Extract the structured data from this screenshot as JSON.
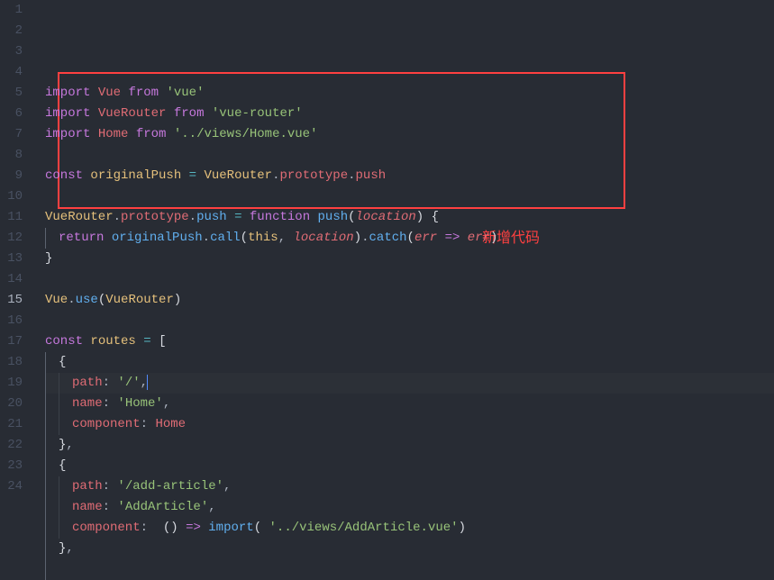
{
  "annotation": "新增代码",
  "lines": [
    {
      "n": 1,
      "segments": [
        {
          "t": "import",
          "c": "k-purple"
        },
        {
          "t": " ",
          "c": ""
        },
        {
          "t": "Vue",
          "c": "k-red"
        },
        {
          "t": " ",
          "c": ""
        },
        {
          "t": "from",
          "c": "k-purple"
        },
        {
          "t": " ",
          "c": ""
        },
        {
          "t": "'vue'",
          "c": "k-green"
        }
      ]
    },
    {
      "n": 2,
      "segments": [
        {
          "t": "import",
          "c": "k-purple"
        },
        {
          "t": " ",
          "c": ""
        },
        {
          "t": "VueRouter",
          "c": "k-red"
        },
        {
          "t": " ",
          "c": ""
        },
        {
          "t": "from",
          "c": "k-purple"
        },
        {
          "t": " ",
          "c": ""
        },
        {
          "t": "'vue-router'",
          "c": "k-green"
        }
      ]
    },
    {
      "n": 3,
      "segments": [
        {
          "t": "import",
          "c": "k-purple"
        },
        {
          "t": " ",
          "c": ""
        },
        {
          "t": "Home",
          "c": "k-red"
        },
        {
          "t": " ",
          "c": ""
        },
        {
          "t": "from",
          "c": "k-purple"
        },
        {
          "t": " ",
          "c": ""
        },
        {
          "t": "'../views/Home.vue'",
          "c": "k-green"
        }
      ]
    },
    {
      "n": 4,
      "segments": []
    },
    {
      "n": 5,
      "segments": [
        {
          "t": "const",
          "c": "k-purple"
        },
        {
          "t": " ",
          "c": ""
        },
        {
          "t": "originalPush",
          "c": "k-yellow"
        },
        {
          "t": " ",
          "c": ""
        },
        {
          "t": "=",
          "c": "k-cyan"
        },
        {
          "t": " ",
          "c": ""
        },
        {
          "t": "VueRouter",
          "c": "k-yellow"
        },
        {
          "t": ".",
          "c": "k-grey"
        },
        {
          "t": "prototype",
          "c": "k-red"
        },
        {
          "t": ".",
          "c": "k-grey"
        },
        {
          "t": "push",
          "c": "k-red"
        }
      ]
    },
    {
      "n": 6,
      "segments": []
    },
    {
      "n": 7,
      "segments": [
        {
          "t": "VueRouter",
          "c": "k-yellow"
        },
        {
          "t": ".",
          "c": "k-grey"
        },
        {
          "t": "prototype",
          "c": "k-red"
        },
        {
          "t": ".",
          "c": "k-grey"
        },
        {
          "t": "push",
          "c": "k-blue"
        },
        {
          "t": " ",
          "c": ""
        },
        {
          "t": "=",
          "c": "k-cyan"
        },
        {
          "t": " ",
          "c": ""
        },
        {
          "t": "function",
          "c": "k-purple"
        },
        {
          "t": " ",
          "c": ""
        },
        {
          "t": "push",
          "c": "k-blue"
        },
        {
          "t": "(",
          "c": "k-white"
        },
        {
          "t": "location",
          "c": "k-red italic"
        },
        {
          "t": ")",
          "c": "k-white"
        },
        {
          "t": " ",
          "c": ""
        },
        {
          "t": "{",
          "c": "k-white"
        }
      ]
    },
    {
      "n": 8,
      "indent": 1,
      "segments": [
        {
          "t": "return",
          "c": "k-purple"
        },
        {
          "t": " ",
          "c": ""
        },
        {
          "t": "originalPush",
          "c": "k-blue"
        },
        {
          "t": ".",
          "c": "k-grey"
        },
        {
          "t": "call",
          "c": "k-blue"
        },
        {
          "t": "(",
          "c": "k-white"
        },
        {
          "t": "this",
          "c": "k-yellow"
        },
        {
          "t": ", ",
          "c": "k-grey"
        },
        {
          "t": "location",
          "c": "k-red italic"
        },
        {
          "t": ")",
          "c": "k-white"
        },
        {
          "t": ".",
          "c": "k-grey"
        },
        {
          "t": "catch",
          "c": "k-blue"
        },
        {
          "t": "(",
          "c": "k-white"
        },
        {
          "t": "err",
          "c": "k-red italic"
        },
        {
          "t": " ",
          "c": ""
        },
        {
          "t": "=>",
          "c": "k-purple"
        },
        {
          "t": " ",
          "c": ""
        },
        {
          "t": "err",
          "c": "k-red italic"
        },
        {
          "t": ")",
          "c": "k-white"
        }
      ]
    },
    {
      "n": 9,
      "segments": [
        {
          "t": "}",
          "c": "k-white"
        }
      ]
    },
    {
      "n": 10,
      "segments": []
    },
    {
      "n": 11,
      "segments": [
        {
          "t": "Vue",
          "c": "k-yellow"
        },
        {
          "t": ".",
          "c": "k-grey"
        },
        {
          "t": "use",
          "c": "k-blue"
        },
        {
          "t": "(",
          "c": "k-white"
        },
        {
          "t": "VueRouter",
          "c": "k-yellow"
        },
        {
          "t": ")",
          "c": "k-white"
        }
      ]
    },
    {
      "n": 12,
      "segments": []
    },
    {
      "n": 13,
      "segments": [
        {
          "t": "const",
          "c": "k-purple"
        },
        {
          "t": " ",
          "c": ""
        },
        {
          "t": "routes",
          "c": "k-yellow"
        },
        {
          "t": " ",
          "c": ""
        },
        {
          "t": "=",
          "c": "k-cyan"
        },
        {
          "t": " ",
          "c": ""
        },
        {
          "t": "[",
          "c": "k-white"
        }
      ]
    },
    {
      "n": 14,
      "indent": 1,
      "segments": [
        {
          "t": "{",
          "c": "k-white"
        }
      ]
    },
    {
      "n": 15,
      "active": true,
      "indent": 2,
      "segments": [
        {
          "t": "path",
          "c": "k-red"
        },
        {
          "t": ": ",
          "c": "k-grey"
        },
        {
          "t": "'/'",
          "c": "k-green"
        },
        {
          "t": ",",
          "c": "k-grey"
        }
      ],
      "cursor": true
    },
    {
      "n": 16,
      "indent": 2,
      "segments": [
        {
          "t": "name",
          "c": "k-red"
        },
        {
          "t": ": ",
          "c": "k-grey"
        },
        {
          "t": "'Home'",
          "c": "k-green"
        },
        {
          "t": ",",
          "c": "k-grey"
        }
      ]
    },
    {
      "n": 17,
      "indent": 2,
      "segments": [
        {
          "t": "component",
          "c": "k-red"
        },
        {
          "t": ": ",
          "c": "k-grey"
        },
        {
          "t": "Home",
          "c": "k-red"
        }
      ]
    },
    {
      "n": 18,
      "indent": 1,
      "segments": [
        {
          "t": "}",
          "c": "k-white"
        },
        {
          "t": ",",
          "c": "k-grey"
        }
      ]
    },
    {
      "n": 19,
      "indent": 1,
      "segments": [
        {
          "t": "{",
          "c": "k-white"
        }
      ]
    },
    {
      "n": 20,
      "indent": 2,
      "segments": [
        {
          "t": "path",
          "c": "k-red"
        },
        {
          "t": ": ",
          "c": "k-grey"
        },
        {
          "t": "'/add-article'",
          "c": "k-green"
        },
        {
          "t": ",",
          "c": "k-grey"
        }
      ]
    },
    {
      "n": 21,
      "indent": 2,
      "segments": [
        {
          "t": "name",
          "c": "k-red"
        },
        {
          "t": ": ",
          "c": "k-grey"
        },
        {
          "t": "'AddArticle'",
          "c": "k-green"
        },
        {
          "t": ",",
          "c": "k-grey"
        }
      ]
    },
    {
      "n": 22,
      "indent": 2,
      "segments": [
        {
          "t": "component",
          "c": "k-red"
        },
        {
          "t": ":  ",
          "c": "k-grey"
        },
        {
          "t": "()",
          "c": "k-white"
        },
        {
          "t": " ",
          "c": ""
        },
        {
          "t": "=>",
          "c": "k-purple"
        },
        {
          "t": " ",
          "c": ""
        },
        {
          "t": "import",
          "c": "k-blue"
        },
        {
          "t": "( ",
          "c": "k-white"
        },
        {
          "t": "'../views/AddArticle.vue'",
          "c": "k-green"
        },
        {
          "t": ")",
          "c": "k-white"
        }
      ]
    },
    {
      "n": 23,
      "indent": 1,
      "segments": [
        {
          "t": "}",
          "c": "k-white"
        },
        {
          "t": ",",
          "c": "k-grey"
        }
      ]
    },
    {
      "n": 24,
      "indent": 1,
      "segments": []
    }
  ]
}
